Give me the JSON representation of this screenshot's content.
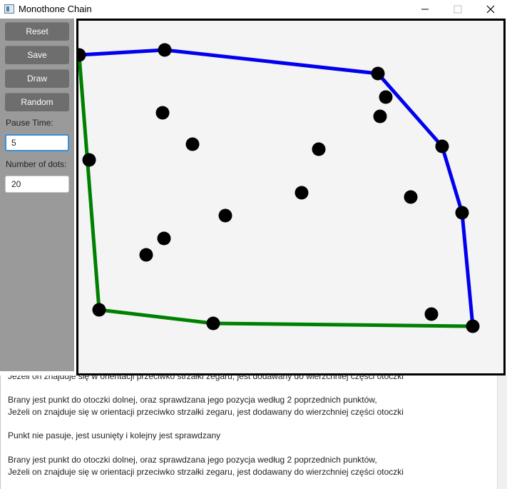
{
  "window": {
    "title": "Monothone Chain",
    "icon": "app-window-icon",
    "controls": [
      "minimize-icon",
      "maximize-icon",
      "close-icon"
    ]
  },
  "sidebar": {
    "buttons": [
      {
        "label": "Reset"
      },
      {
        "label": "Save"
      },
      {
        "label": "Draw"
      },
      {
        "label": "Random"
      }
    ],
    "pause_time_label": "Pause Time:",
    "pause_time_value": "5",
    "dots_label": "Number of dots:",
    "dots_value": "20"
  },
  "hull": {
    "upper_color": "#0000ee",
    "lower_color": "#008000",
    "point_color": "#000000"
  },
  "log": {
    "lines": [
      "Jeżeli on znajduje się w orientacji przeciwko strzałki zegaru, jest dodawany do wierzchniej części otoczki",
      "Brany jest punkt do otoczki dolnej, oraz sprawdzana jego pozycja według 2 poprzednich punktów,",
      "Jeżeli on znajduje się w orientacji przeciwko strzałki zegaru, jest dodawany do wierzchniej części otoczki",
      "Punkt nie pasuje, jest usunięty i kolejny jest sprawdzany",
      "Brany jest punkt do otoczki dolnej, oraz sprawdzana jego pozycja według 2 poprzednich punktów,",
      "Jeżeli on znajduje się w orientacji przeciwko strzałki zegaru, jest dodawany do wierzchniej części otoczki"
    ]
  }
}
